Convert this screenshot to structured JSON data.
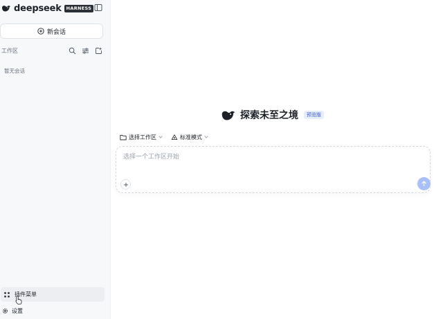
{
  "brand": {
    "name": "deepseek",
    "badge": "HARNESS"
  },
  "sidebar": {
    "new_chat_label": "新会话",
    "workspace_title": "工作区",
    "empty_text": "暂无会话",
    "plugin_menu_label": "插件菜单",
    "settings_label": "设置"
  },
  "main": {
    "hero_title": "探索未至之境",
    "hero_badge": "预览版",
    "toolbar": {
      "workspace_label": "选择工作区",
      "mode_label": "标准模式"
    },
    "composer": {
      "placeholder": "选择一个工作区开始",
      "value": ""
    }
  },
  "colors": {
    "accent": "#3b5bdb",
    "send_button": "#a8bff7",
    "sidebar_bg": "#f6f8fa",
    "badge_bg": "#e6edfc"
  },
  "icons": {
    "brand": "whale-logo-icon",
    "collapse": "sidebar-toggle-icon",
    "new_chat": "plus-circle-icon",
    "search": "search-icon",
    "filter": "filter-icon",
    "new_folder": "new-window-icon",
    "plugin": "grid-icon",
    "settings": "gear-icon",
    "folder": "folder-icon",
    "mode": "recycle-icon",
    "attach": "plus-icon",
    "send": "arrow-up-icon"
  }
}
